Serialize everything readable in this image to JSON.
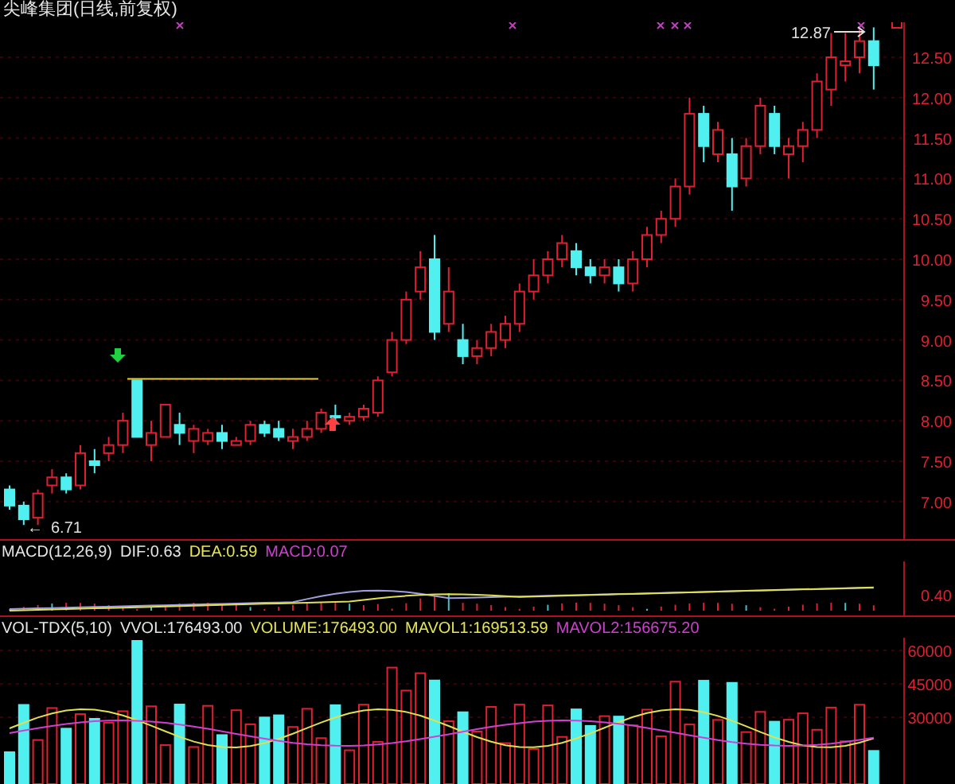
{
  "title": "尖峰集团(日线,前复权)",
  "price_panel": {
    "axis_labels": [
      "12.50",
      "12.00",
      "11.50",
      "11.00",
      "10.50",
      "10.00",
      "9.50",
      "9.00",
      "8.50",
      "8.00",
      "7.50",
      "7.00"
    ],
    "high_label": "12.87",
    "low_arrow": "←",
    "low_label": "6.71"
  },
  "macd_panel": {
    "indicators": [
      {
        "text": "MACD(12,26,9)",
        "color": "#e6e6e6"
      },
      {
        "text": "DIF:0.63",
        "color": "#e6e6e6"
      },
      {
        "text": "DEA:0.59",
        "color": "#e6e650"
      },
      {
        "text": "MACD:0.07",
        "color": "#d040d0"
      }
    ],
    "axis_labels": [
      "0.40"
    ]
  },
  "volume_panel": {
    "indicators": [
      {
        "text": "VOL-TDX(5,10)",
        "color": "#e6e6e6"
      },
      {
        "text": "VVOL:176493.00",
        "color": "#e6e6e6"
      },
      {
        "text": "VOLUME:176493.00",
        "color": "#e6e650"
      },
      {
        "text": "MAVOL1:169513.59",
        "color": "#e6e650"
      },
      {
        "text": "MAVOL2:156675.20",
        "color": "#d040d0"
      }
    ],
    "axis_labels": [
      "60000",
      "45000",
      "30000"
    ]
  }
}
